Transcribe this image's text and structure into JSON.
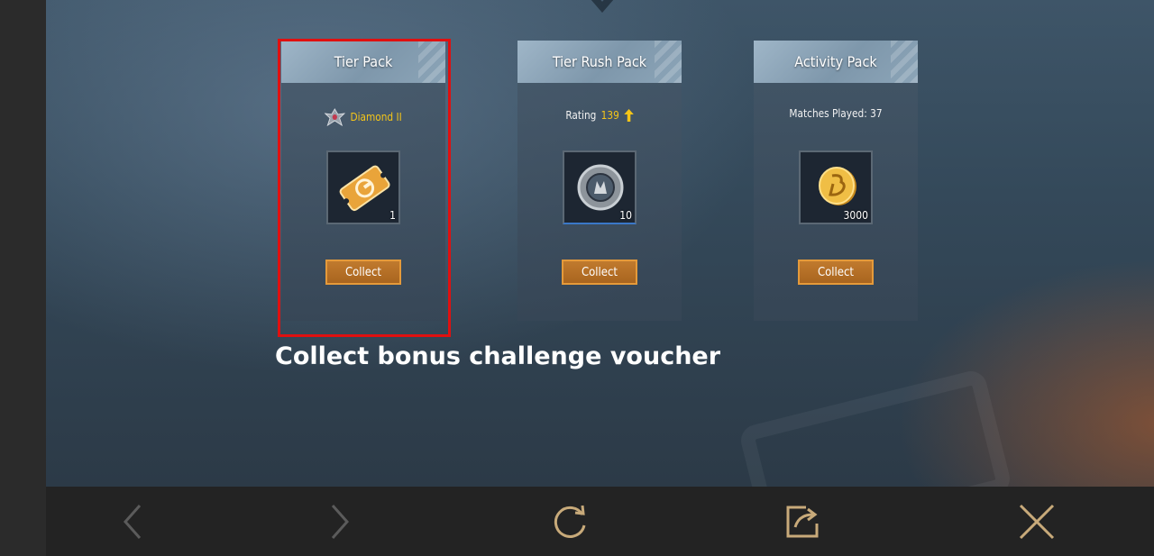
{
  "cards": [
    {
      "title": "Tier Pack",
      "info_value": "Diamond II",
      "info_icon": "rank-badge-icon",
      "reward_icon": "gold-voucher-icon",
      "quantity": "1",
      "button": "Collect"
    },
    {
      "title": "Tier Rush Pack",
      "info_label": "Rating",
      "info_value": "139",
      "info_icon": "up-arrow-icon",
      "reward_icon": "silver-crate-coupon-icon",
      "quantity": "10",
      "button": "Collect"
    },
    {
      "title": "Activity Pack",
      "info_label": "Matches Played: 37",
      "reward_icon": "bp-coin-icon",
      "quantity": "3000",
      "button": "Collect"
    }
  ],
  "caption": "Collect bonus challenge voucher",
  "toolbar": [
    "back-icon",
    "forward-icon",
    "refresh-icon",
    "share-icon",
    "close-icon"
  ],
  "colors": {
    "accent_gold": "#f5c518",
    "button_orange": "#c07a2e",
    "highlight_red": "#e01010"
  }
}
